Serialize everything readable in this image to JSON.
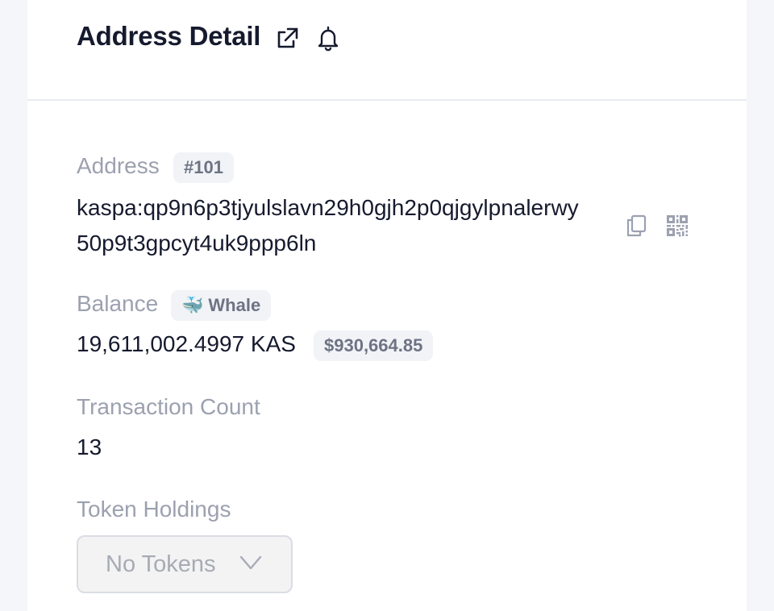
{
  "header": {
    "title": "Address Detail",
    "icons": [
      "external-link-icon",
      "bell-icon"
    ]
  },
  "address": {
    "label": "Address",
    "rank_badge": "#101",
    "line1": "kaspa:qp9n6p3tjyulslavn29h0gjh2p0qjgylpnalerwy",
    "line2": "50p9t3gpcyt4uk9ppp6ln",
    "icons": [
      "copy-icon",
      "qr-code-icon"
    ]
  },
  "balance": {
    "label": "Balance",
    "tag_emoji": "🐳",
    "tag_label": "Whale",
    "amount": "19,611,002.4997 KAS",
    "usd": "$930,664.85"
  },
  "transactions": {
    "label": "Transaction Count",
    "count": "13"
  },
  "tokens": {
    "label": "Token Holdings",
    "dropdown_value": "No Tokens",
    "icon": "chevron-down-icon"
  },
  "colors": {
    "page_bg": "#f4f6f9",
    "card_bg": "#ffffff",
    "text_primary": "#161a2e",
    "text_muted": "#9ca1b0",
    "badge_bg": "#f1f3f7"
  }
}
